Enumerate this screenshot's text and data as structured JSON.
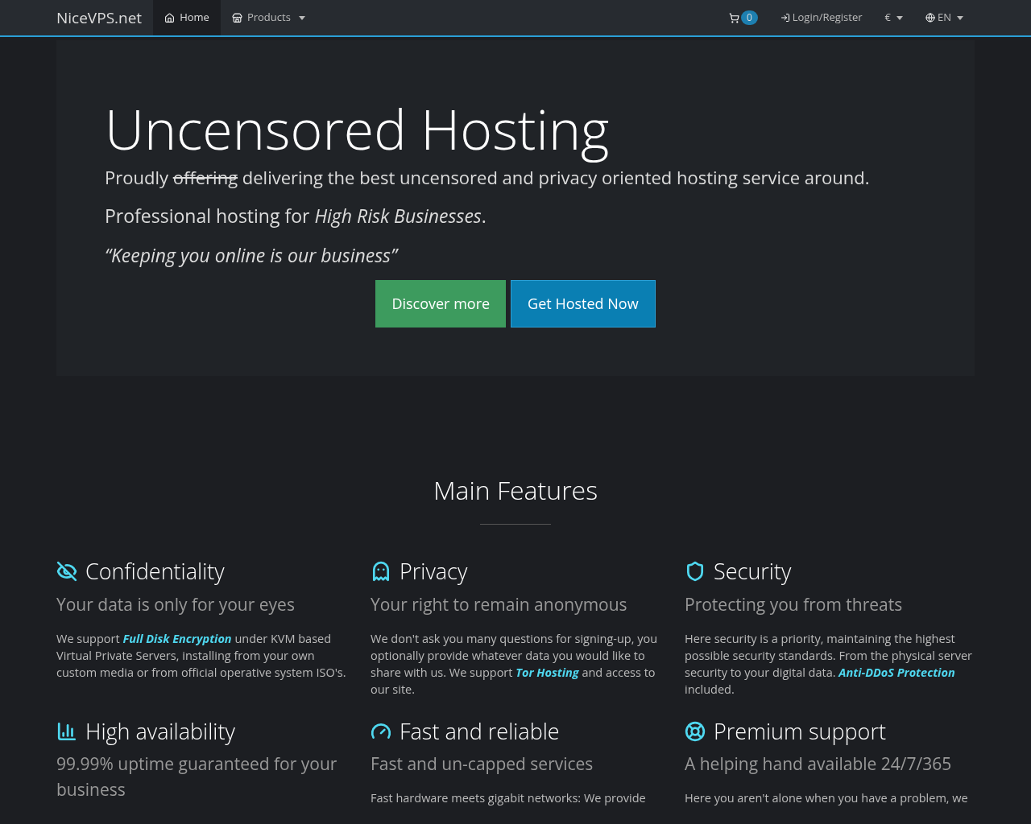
{
  "navbar": {
    "brand": "NiceVPS.net",
    "items": [
      {
        "kind": "home",
        "label": "Home",
        "selected": true,
        "dropdown": false
      },
      {
        "kind": "products",
        "label": "Products",
        "selected": false,
        "dropdown": true
      }
    ],
    "right": [
      {
        "kind": "cart",
        "label": "0",
        "dropdown": false
      },
      {
        "kind": "login",
        "label": "Login/Register",
        "dropdown": false
      },
      {
        "kind": "currency",
        "label": "€",
        "dropdown": true
      },
      {
        "kind": "language",
        "label": "EN",
        "dropdown": true
      }
    ]
  },
  "hero": {
    "title": "Uncensored Hosting",
    "lead": [
      {
        "text": "Proudly ",
        "struck": false
      },
      {
        "text": "offering",
        "struck": true
      },
      {
        "text": " delivering the best uncensored and privacy oriented hosting service around.",
        "struck": false
      }
    ],
    "tagline": "Professional hosting for *High Risk Businesses*.",
    "quote": "“Keeping you online is our business”",
    "buttons": [
      {
        "kind": "secondary",
        "label": "Discover more"
      },
      {
        "kind": "primary",
        "label": "Get Hosted Now"
      }
    ]
  },
  "features": {
    "title": "Main Features",
    "items": [
      {
        "kind": "eye-off",
        "title": "Confidentiality",
        "subtitle": "Your data is only for your eyes",
        "body": "We support **Full Disk Encryption** under KVM based Virtual Private Servers, installing from your own custom media or from official operative system ISO's."
      },
      {
        "kind": "ghost",
        "title": "Privacy",
        "subtitle": "Your right to remain anonymous",
        "body": "We don't ask you many questions for signing-up, you optionally provide whatever data you would like to share with us. We support **Tor Hosting** and access to our site."
      },
      {
        "kind": "shield",
        "title": "Security",
        "subtitle": "Protecting you from threats",
        "body": "Here security is a priority, maintaining the highest possible security standards. From the physical server security to your digital data. **Anti-DDoS Protection** included."
      },
      {
        "kind": "bars",
        "title": "High availability",
        "subtitle": "99.99% uptime guaranteed for your business"
      },
      {
        "kind": "gauge",
        "title": "Fast and reliable",
        "subtitle": "Fast and un-capped services",
        "body": "Fast hardware meets gigabit networks: We provide"
      },
      {
        "kind": "lifebuoy",
        "title": "Premium support",
        "subtitle": "A helping hand available 24/7/365",
        "body": "Here you aren't alone when you have a problem, we"
      }
    ]
  }
}
